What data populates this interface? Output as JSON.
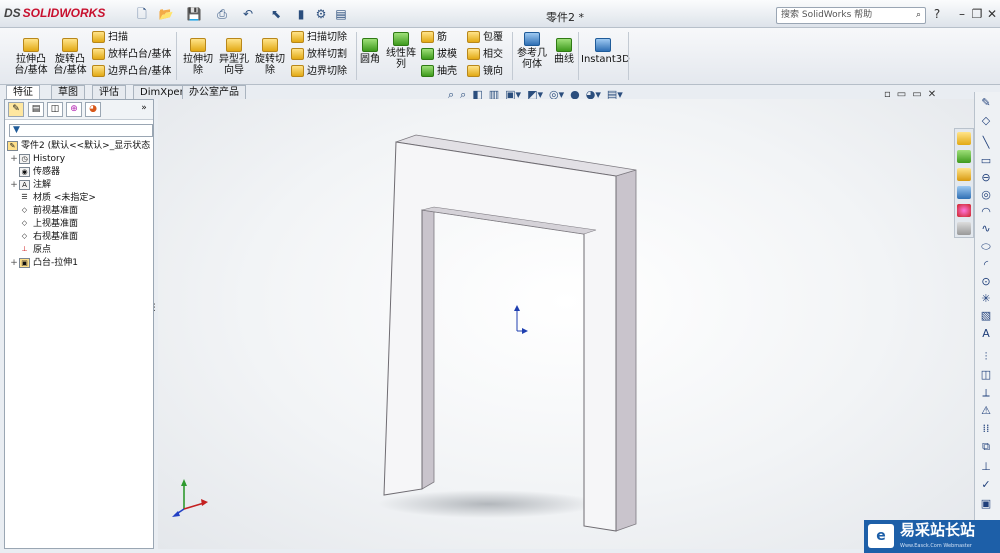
{
  "app": {
    "brand_prefix": "DS",
    "brand_name": "SOLIDWORKS",
    "document_title": "零件2 *",
    "search_placeholder": "搜索 SolidWorks 帮助"
  },
  "quick_access": [
    "new-icon",
    "open-icon",
    "save-icon",
    "print-icon",
    "undo-icon",
    "select-icon",
    "traffic-light-icon",
    "options-icon"
  ],
  "window_controls": {
    "help": "?",
    "minimize": "–",
    "restore": "❐",
    "close": "✕"
  },
  "ribbon": {
    "extrude_boss": "拉伸凸\n台/基体",
    "revolve_boss": "旋转凸\n台/基体",
    "sweep": "扫描",
    "loft": "放样凸台/基体",
    "boundary_boss": "边界凸台/基体",
    "extrude_cut": "拉伸切\n除",
    "hole_wizard": "异型孔\n向导",
    "revolve_cut": "旋转切\n除",
    "swept_cut": "扫描切除",
    "lofted_cut": "放样切割",
    "boundary_cut": "边界切除",
    "fillet": "圆角",
    "linear_pattern": "线性阵\n列",
    "rib": "筋",
    "draft": "拔模",
    "shell": "抽壳",
    "wrap": "包覆",
    "intersect": "相交",
    "mirror": "镜向",
    "ref_geometry": "参考几\n何体",
    "curves": "曲线",
    "instant3d": "Instant3D"
  },
  "tabs": [
    {
      "label": "特征",
      "active": true
    },
    {
      "label": "草图",
      "active": false
    },
    {
      "label": "评估",
      "active": false
    },
    {
      "label": "DimXpert",
      "active": false
    },
    {
      "label": "办公室产品",
      "active": false
    }
  ],
  "feature_tree": {
    "root": "零件2 (默认<<默认>_显示状态",
    "items": [
      {
        "label": "History",
        "expandable": true,
        "icon": "history-icon"
      },
      {
        "label": "传感器",
        "expandable": false,
        "icon": "sensor-icon"
      },
      {
        "label": "注解",
        "expandable": true,
        "icon": "annotation-icon"
      },
      {
        "label": "材质 <未指定>",
        "expandable": false,
        "icon": "material-icon"
      },
      {
        "label": "前视基准面",
        "expandable": false,
        "icon": "plane-icon"
      },
      {
        "label": "上视基准面",
        "expandable": false,
        "icon": "plane-icon"
      },
      {
        "label": "右视基准面",
        "expandable": false,
        "icon": "plane-icon"
      },
      {
        "label": "原点",
        "expandable": false,
        "icon": "origin-icon"
      },
      {
        "label": "凸台-拉伸1",
        "expandable": true,
        "icon": "extrude-feature-icon"
      }
    ]
  },
  "watermark": {
    "text": "易采站长站",
    "sub": "Www.Easck.Com Webmaster"
  },
  "colors": {
    "part_face": "#f6f6f8",
    "part_side": "#c9c4cc",
    "accent": "#1d5fa8",
    "brand": "#c8102e"
  }
}
